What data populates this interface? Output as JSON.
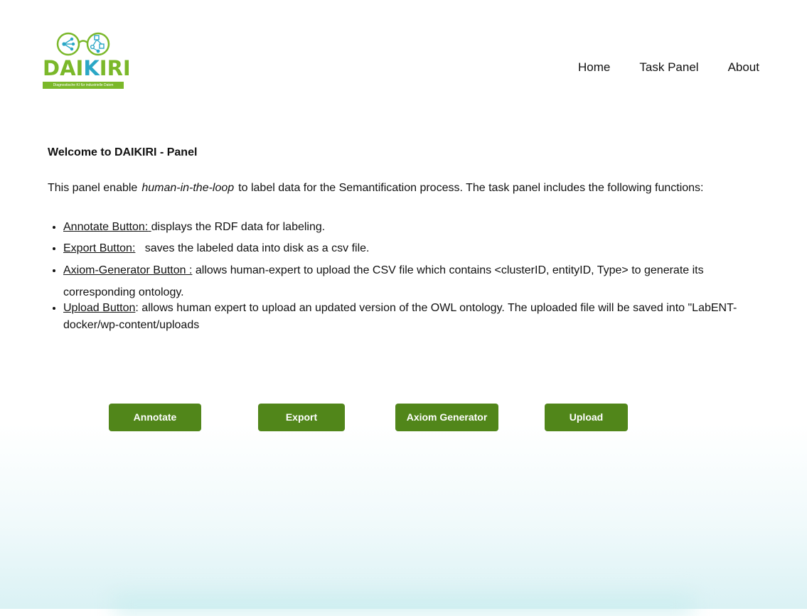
{
  "logo": {
    "brand_main": "DAI",
    "brand_accent": "K",
    "brand_rest": "IRI",
    "tagline": "Diagnostische KI für industrielle Daten",
    "colors": {
      "green": "#7bb82a",
      "blue": "#2ba7c6"
    }
  },
  "nav": {
    "items": [
      {
        "label": "Home"
      },
      {
        "label": "Task Panel"
      },
      {
        "label": "About"
      }
    ]
  },
  "content": {
    "welcome": "Welcome to DAIKIRI - Panel",
    "intro_before": "This panel enable",
    "intro_emphasis": "human-in-the-loop",
    "intro_after": "to label data for the Semantification process. The task panel includes the following functions:",
    "functions": [
      {
        "label": "Annotate Button:",
        "sep": " ",
        "text": "displays the RDF data for labeling."
      },
      {
        "label": "Export Button:",
        "sep": "",
        "text": "   saves the labeled data into disk as a csv file."
      },
      {
        "label": "Axiom-Generator Button",
        "sep": " :",
        "text": " allows human-expert to upload the CSV file which contains <clusterID, entityID, Type> to generate its corresponding ontology."
      },
      {
        "label": "Upload Button",
        "sep": "",
        "text": ":  allows human expert to upload an updated version of the OWL ontology.  The uploaded file will be saved into \"LabENT-docker/wp-content/uploads"
      }
    ]
  },
  "buttons": {
    "annotate": "Annotate",
    "export": "Export",
    "axiom": "Axiom Generator",
    "upload": "Upload"
  },
  "colors": {
    "button_bg": "#51861a",
    "button_text": "#ffffff"
  }
}
